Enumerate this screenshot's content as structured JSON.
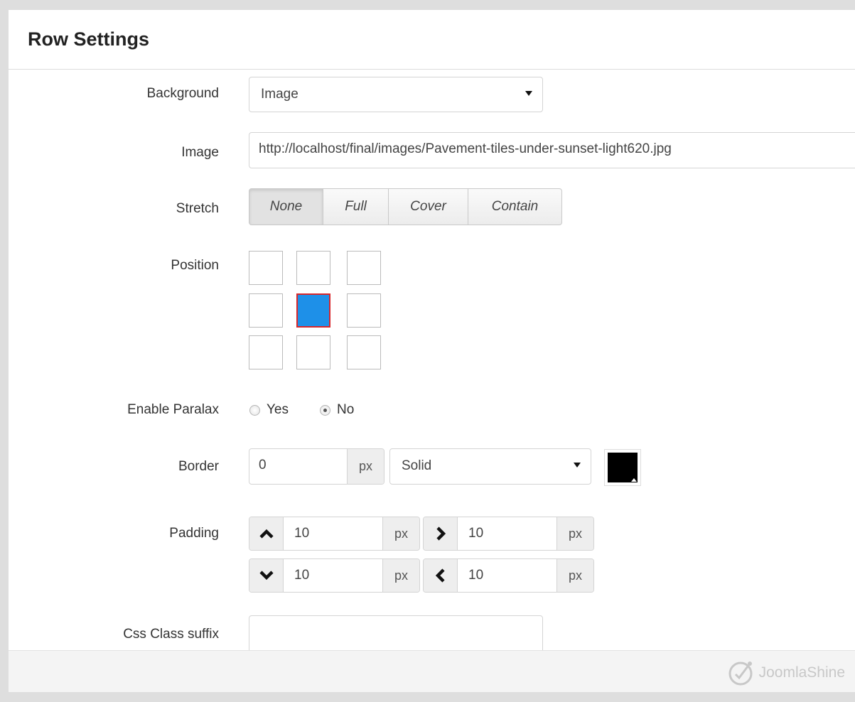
{
  "header": {
    "title": "Row Settings"
  },
  "background": {
    "label": "Background",
    "value": "Image"
  },
  "image": {
    "label": "Image",
    "value": "http://localhost/final/images/Pavement-tiles-under-sunset-light620.jpg"
  },
  "stretch": {
    "label": "Stretch",
    "options": [
      "None",
      "Full",
      "Cover",
      "Contain"
    ],
    "selected": "None"
  },
  "position": {
    "label": "Position",
    "selected_cell": "middle-center"
  },
  "parallax": {
    "label": "Enable Paralax",
    "yes_label": "Yes",
    "no_label": "No",
    "selected": "No"
  },
  "border": {
    "label": "Border",
    "width": "0",
    "unit": "px",
    "style": "Solid",
    "color": "#000000"
  },
  "padding": {
    "label": "Padding",
    "top": {
      "value": "10",
      "unit": "px"
    },
    "right": {
      "value": "10",
      "unit": "px"
    },
    "bottom": {
      "value": "10",
      "unit": "px"
    },
    "left": {
      "value": "10",
      "unit": "px"
    }
  },
  "css_suffix": {
    "label": "Css Class suffix",
    "value": ""
  },
  "footer": {
    "brand": "JoomlaShine"
  },
  "colors": {
    "selected_cell": "#1e90e8",
    "selected_cell_border": "#d8262a"
  }
}
